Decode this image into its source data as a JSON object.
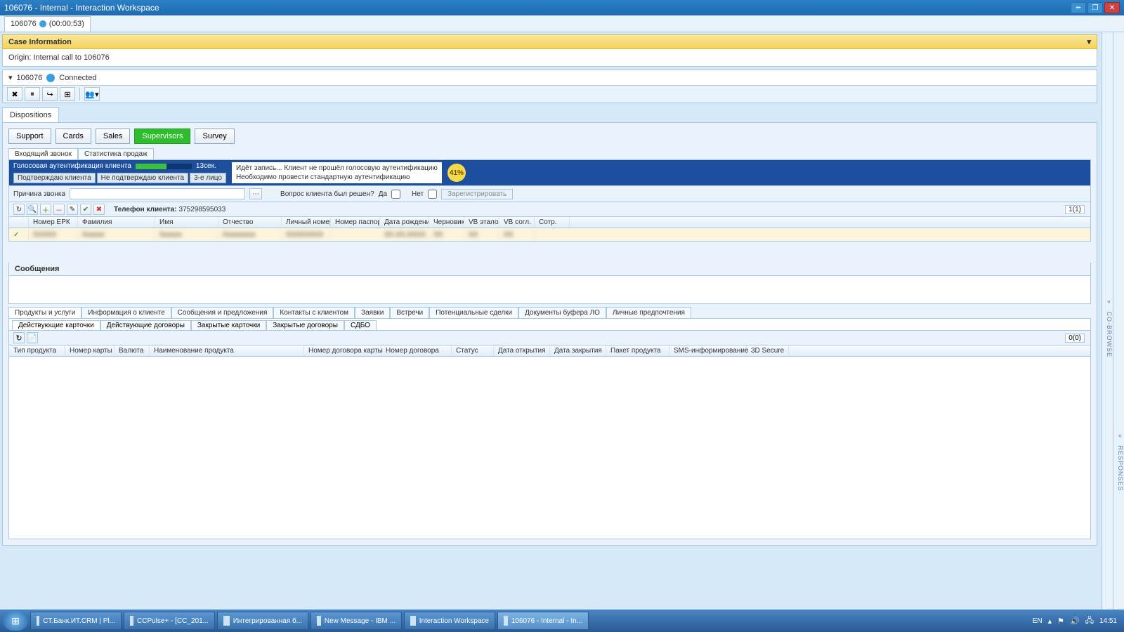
{
  "window": {
    "title": "106076 - Internal - Interaction Workspace"
  },
  "session": {
    "id": "106076",
    "timer": "(00:00:53)"
  },
  "case": {
    "header": "Case Information",
    "origin_label": "Origin:",
    "origin_value": "Internal call to 106076",
    "connected_id": "106076",
    "connected_status": "Connected"
  },
  "dispositions": {
    "tab_label": "Dispositions",
    "categories": [
      "Support",
      "Cards",
      "Sales",
      "Supervisors",
      "Survey"
    ],
    "subtabs": [
      "Входящий звонок",
      "Статистика продаж"
    ],
    "voice": {
      "title": "Голосовая аутентификация клиента",
      "seconds": "13сек.",
      "confirm_btns": [
        "Подтверждаю клиента",
        "Не подтверждаю клиента",
        "3-е лицо"
      ],
      "msg1": "Идёт запись... Клиент не прошёл голосовую аутентификацию",
      "msg2": "Необходимо провести стандартную аутентификацию",
      "percent": "41%"
    },
    "reason": {
      "label": "Причина звонка",
      "question": "Вопрос клиента был решен?",
      "yes": "Да",
      "no": "Нет",
      "register": "Зарегистрировать"
    }
  },
  "client": {
    "phone_label": "Телефон клиента:",
    "phone_value": "375298595033",
    "count": "1(1)",
    "headers": [
      "",
      "Номер ЕРК",
      "Фамилия",
      "Имя",
      "Отчество",
      "Личный номер",
      "Номер паспорта",
      "Дата рождения",
      "Черновик",
      "VB эталон",
      "VB согл.",
      "Сотр."
    ],
    "row": [
      "✓",
      "XXXXX",
      "Xxxxxx",
      "Xxxxxx",
      "Xxxxxxxxx",
      "XXXXXXXX",
      "",
      "XX.XX.XXXX",
      "XX",
      "XX",
      "XX",
      ""
    ]
  },
  "messages": {
    "title": "Сообщения"
  },
  "lower": {
    "tabs": [
      "Продукты и услуги",
      "Информация о клиенте",
      "Сообщения и предложения",
      "Контакты с клиентом",
      "Заявки",
      "Встречи",
      "Потенциальные сделки",
      "Документы буфера ЛО",
      "Личные предпочтения"
    ],
    "subtabs": [
      "Действующие карточки",
      "Действующие договоры",
      "Закрытые карточки",
      "Закрытые договоры",
      "СДБО"
    ],
    "count": "0(0)",
    "headers": [
      "Тип продукта",
      "Номер карты",
      "Валюта",
      "Наименование продукта",
      "Номер договора карты",
      "Номер договора",
      "Статус",
      "Дата открытия",
      "Дата закрытия",
      "Пакет продукта",
      "SMS-информирование",
      "3D Secure"
    ]
  },
  "side": {
    "top": "CO-BROWSE",
    "bottom": "RESPONSES"
  },
  "taskbar": {
    "items": [
      "СТ.Банк.ИТ.CRM | Pl...",
      "CCPulse+ - [CC_201...",
      "Интегрированная б...",
      "New Message - IBM ...",
      "Interaction Workspace",
      "106076 - Internal - In..."
    ],
    "lang": "EN",
    "time": "14:51"
  }
}
